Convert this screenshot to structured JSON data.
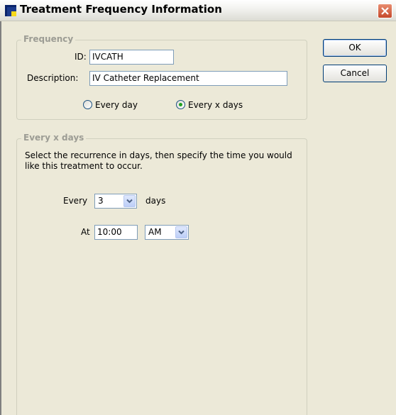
{
  "window": {
    "title": "Treatment Frequency Information",
    "icon": "app-icon",
    "close_icon": "close-icon"
  },
  "frequency_group": {
    "legend": "Frequency",
    "id_label": "ID:",
    "id_value": "IVCATH",
    "description_label": "Description:",
    "description_value": "IV Catheter Replacement",
    "radio_every_day": "Every day",
    "radio_every_x_days": "Every x days",
    "selected_radio": "Every x days"
  },
  "every_x_days_group": {
    "legend": "Every x days",
    "instructions_line1": "Select the recurrence in days, then specify the time you would",
    "instructions_line2": "like this treatment to occur.",
    "every_label": "Every",
    "days_value": "3",
    "days_label": "days",
    "at_label": "At",
    "time_value": "10:00",
    "ampm_value": "AM"
  },
  "buttons": {
    "ok": "OK",
    "cancel": "Cancel"
  }
}
